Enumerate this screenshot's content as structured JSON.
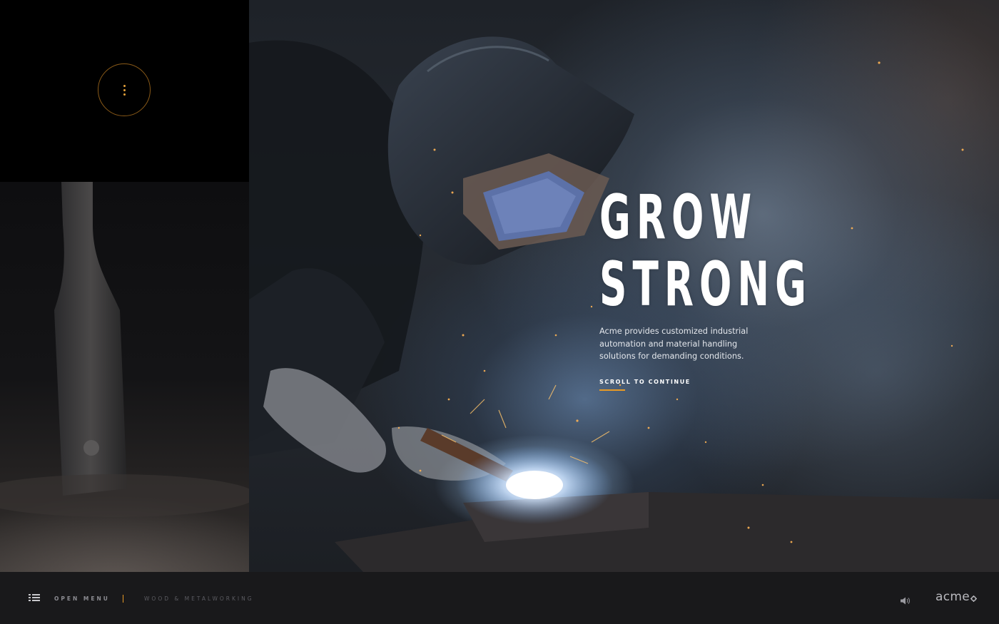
{
  "hero": {
    "headline_line1": "GROW",
    "headline_line2": "STRONG",
    "description": "Acme provides customized industrial automation and material handling solutions for demanding conditions.",
    "cta_label": "SCROLL TO CONTINUE"
  },
  "footer": {
    "menu_label": "OPEN MENU",
    "section_label": "WOOD & METALWORKING",
    "logo_text": "acme",
    "menu_icon": "list-icon",
    "sound_icon": "speaker-icon",
    "logo_icon": "gear-icon"
  },
  "sidebar": {
    "menu_button_icon": "vertical-dots-icon"
  },
  "colors": {
    "accent": "#e89a25",
    "footer_bg": "#19191b",
    "menu_panel_bg": "#000000",
    "headline": "#ffffff"
  }
}
